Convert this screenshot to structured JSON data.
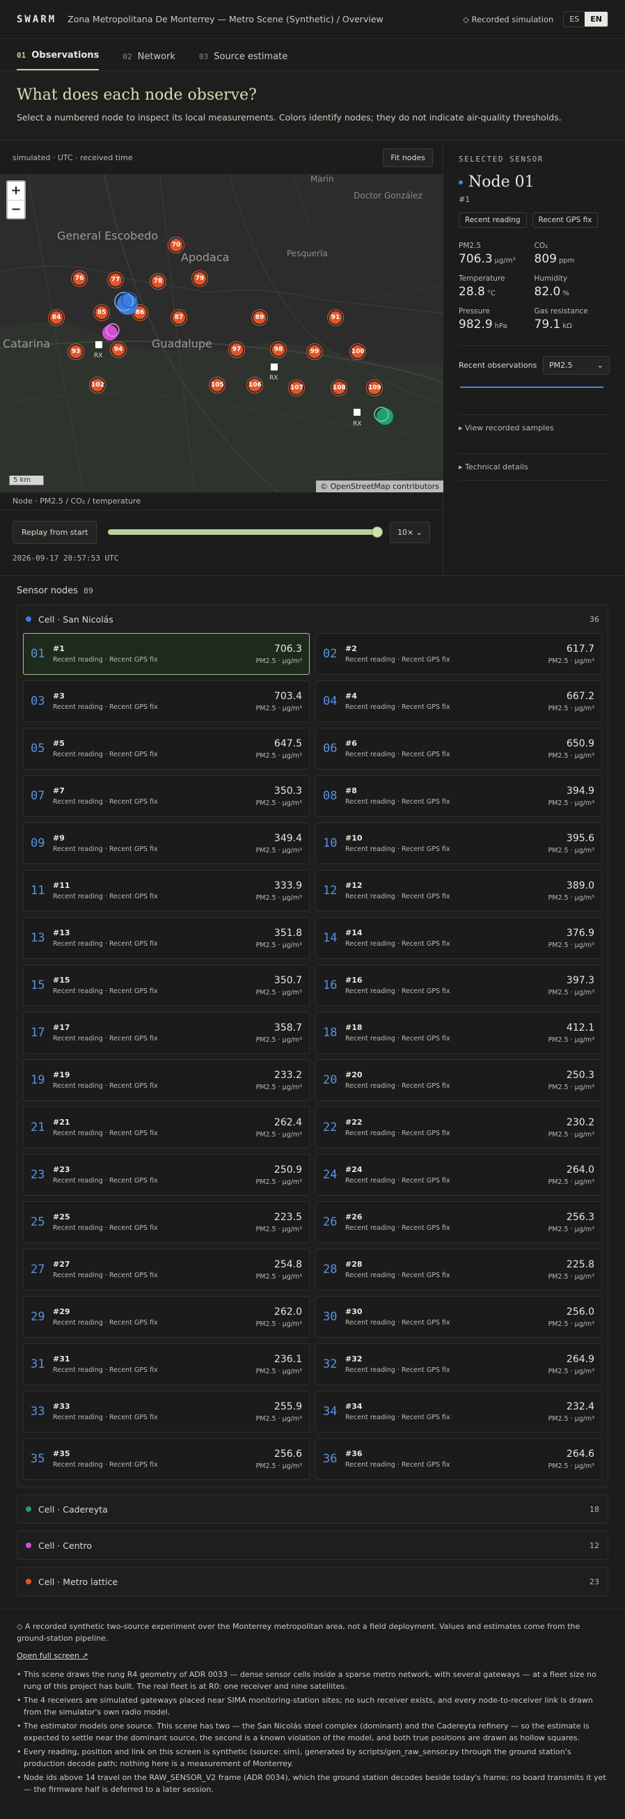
{
  "topbar": {
    "brand": "SWARM",
    "crumb": "Zona Metropolitana De Monterrey — Metro Scene (Synthetic) / Overview",
    "recorded": "◇ Recorded simulation",
    "lang": [
      "ES",
      "EN"
    ]
  },
  "tabs": [
    {
      "n": "01",
      "label": "Observations"
    },
    {
      "n": "02",
      "label": "Network"
    },
    {
      "n": "03",
      "label": "Source estimate"
    }
  ],
  "intro": {
    "title": "What does each node observe?",
    "desc": "Select a numbered node to inspect its local measurements. Colors identify nodes; they do not indicate air-quality thresholds."
  },
  "map": {
    "status": "simulated · UTC · received time",
    "fit_label": "Fit nodes",
    "zoom_in": "+",
    "zoom_out": "−",
    "scale": "5 km",
    "attribution": "© OpenStreetMap contributors",
    "places": {
      "escobedo": "General Escobedo",
      "apodaca": "Apodaca",
      "guadalupe": "Guadalupe",
      "catarina": "Catarina",
      "marin": "Marín",
      "gonzalez": "Doctor González",
      "pesqueria": "Pesquería"
    },
    "markers": [
      "70",
      "76",
      "77",
      "78",
      "79",
      "84",
      "85",
      "86",
      "87",
      "89",
      "91",
      "93",
      "94",
      "97",
      "98",
      "99",
      "100",
      "102",
      "105",
      "106",
      "107",
      "108",
      "109"
    ],
    "rx": "RX",
    "footer": "Node · PM2.5 / CO₂ / temperature"
  },
  "replay": {
    "label": "Replay from start",
    "speed": "10×",
    "progress": 1.0,
    "timestamp": "2026-09-17 20:57:53 UTC"
  },
  "sensor": {
    "eyebrow": "SELECTED SENSOR",
    "title": "Node 01",
    "id": "#1",
    "chips": [
      "Recent reading",
      "Recent GPS fix"
    ],
    "metrics": [
      {
        "k": "PM2.5",
        "v": "706.3",
        "u": "µg/m³"
      },
      {
        "k": "CO₂",
        "v": "809",
        "u": "ppm"
      },
      {
        "k": "Temperature",
        "v": "28.8",
        "u": "°C"
      },
      {
        "k": "Humidity",
        "v": "82.0",
        "u": "%"
      },
      {
        "k": "Pressure",
        "v": "982.9",
        "u": "hPa"
      },
      {
        "k": "Gas resistance",
        "v": "79.1",
        "u": "kΩ"
      }
    ],
    "recent_label": "Recent observations",
    "recent_select": "PM2.5",
    "view_samples": "▸ View recorded samples",
    "tech": "▸ Technical details",
    "accent": "#4a86e8"
  },
  "nodes": {
    "title": "Sensor nodes",
    "count": "89",
    "unit": "PM2.5 · µg/m³",
    "sub": "Recent reading · Recent GPS fix",
    "cells": [
      {
        "name": "Cell · San Nicolás",
        "count": "36",
        "color": "#3b7de0",
        "items": [
          {
            "num": "01",
            "id": "#1",
            "val": "706.3"
          },
          {
            "num": "02",
            "id": "#2",
            "val": "617.7"
          },
          {
            "num": "03",
            "id": "#3",
            "val": "703.4"
          },
          {
            "num": "04",
            "id": "#4",
            "val": "667.2"
          },
          {
            "num": "05",
            "id": "#5",
            "val": "647.5"
          },
          {
            "num": "06",
            "id": "#6",
            "val": "650.9"
          },
          {
            "num": "07",
            "id": "#7",
            "val": "350.3"
          },
          {
            "num": "08",
            "id": "#8",
            "val": "394.9"
          },
          {
            "num": "09",
            "id": "#9",
            "val": "349.4"
          },
          {
            "num": "10",
            "id": "#10",
            "val": "395.6"
          },
          {
            "num": "11",
            "id": "#11",
            "val": "333.9"
          },
          {
            "num": "12",
            "id": "#12",
            "val": "389.0"
          },
          {
            "num": "13",
            "id": "#13",
            "val": "351.8"
          },
          {
            "num": "14",
            "id": "#14",
            "val": "376.9"
          },
          {
            "num": "15",
            "id": "#15",
            "val": "350.7"
          },
          {
            "num": "16",
            "id": "#16",
            "val": "397.3"
          },
          {
            "num": "17",
            "id": "#17",
            "val": "358.7"
          },
          {
            "num": "18",
            "id": "#18",
            "val": "412.1"
          },
          {
            "num": "19",
            "id": "#19",
            "val": "233.2"
          },
          {
            "num": "20",
            "id": "#20",
            "val": "250.3"
          },
          {
            "num": "21",
            "id": "#21",
            "val": "262.4"
          },
          {
            "num": "22",
            "id": "#22",
            "val": "230.2"
          },
          {
            "num": "23",
            "id": "#23",
            "val": "250.9"
          },
          {
            "num": "24",
            "id": "#24",
            "val": "264.0"
          },
          {
            "num": "25",
            "id": "#25",
            "val": "223.5"
          },
          {
            "num": "26",
            "id": "#26",
            "val": "256.3"
          },
          {
            "num": "27",
            "id": "#27",
            "val": "254.8"
          },
          {
            "num": "28",
            "id": "#28",
            "val": "225.8"
          },
          {
            "num": "29",
            "id": "#29",
            "val": "262.0"
          },
          {
            "num": "30",
            "id": "#30",
            "val": "256.0"
          },
          {
            "num": "31",
            "id": "#31",
            "val": "236.1"
          },
          {
            "num": "32",
            "id": "#32",
            "val": "264.9"
          },
          {
            "num": "33",
            "id": "#33",
            "val": "255.9"
          },
          {
            "num": "34",
            "id": "#34",
            "val": "232.4"
          },
          {
            "num": "35",
            "id": "#35",
            "val": "256.6"
          },
          {
            "num": "36",
            "id": "#36",
            "val": "264.6"
          }
        ]
      },
      {
        "name": "Cell · Cadereyta",
        "count": "18",
        "color": "#22a06b",
        "items": []
      },
      {
        "name": "Cell · Centro",
        "count": "12",
        "color": "#d04fd0",
        "items": []
      },
      {
        "name": "Cell · Metro lattice",
        "count": "23",
        "color": "#e0562b",
        "items": []
      }
    ]
  },
  "footer": {
    "intro": "◇ A recorded synthetic two-source experiment over the Monterrey metropolitan area, not a field deployment. Values and estimates come from the ground-station pipeline.",
    "link": "Open full screen ↗",
    "bullets": [
      "This scene draws the rung R4 geometry of ADR 0033 — dense sensor cells inside a sparse metro network, with several gateways — at a fleet size no rung of this project has built. The real fleet is at R0: one receiver and nine satellites.",
      "The 4 receivers are simulated gateways placed near SIMA monitoring-station sites; no such receiver exists, and every node-to-receiver link is drawn from the simulator's own radio model.",
      "The estimator models one source. This scene has two — the San Nicolás steel complex (dominant) and the Cadereyta refinery — so the estimate is expected to settle near the dominant source, the second is a known violation of the model, and both true positions are drawn as hollow squares.",
      "Every reading, position and link on this screen is synthetic (source: sim), generated by scripts/gen_raw_sensor.py through the ground station's production decode path; nothing here is a measurement of Monterrey.",
      "Node ids above 14 travel on the RAW_SENSOR_V2 frame (ADR 0034), which the ground station decodes beside today's frame; no board transmits it yet — the firmware half is deferred to a later session."
    ]
  }
}
